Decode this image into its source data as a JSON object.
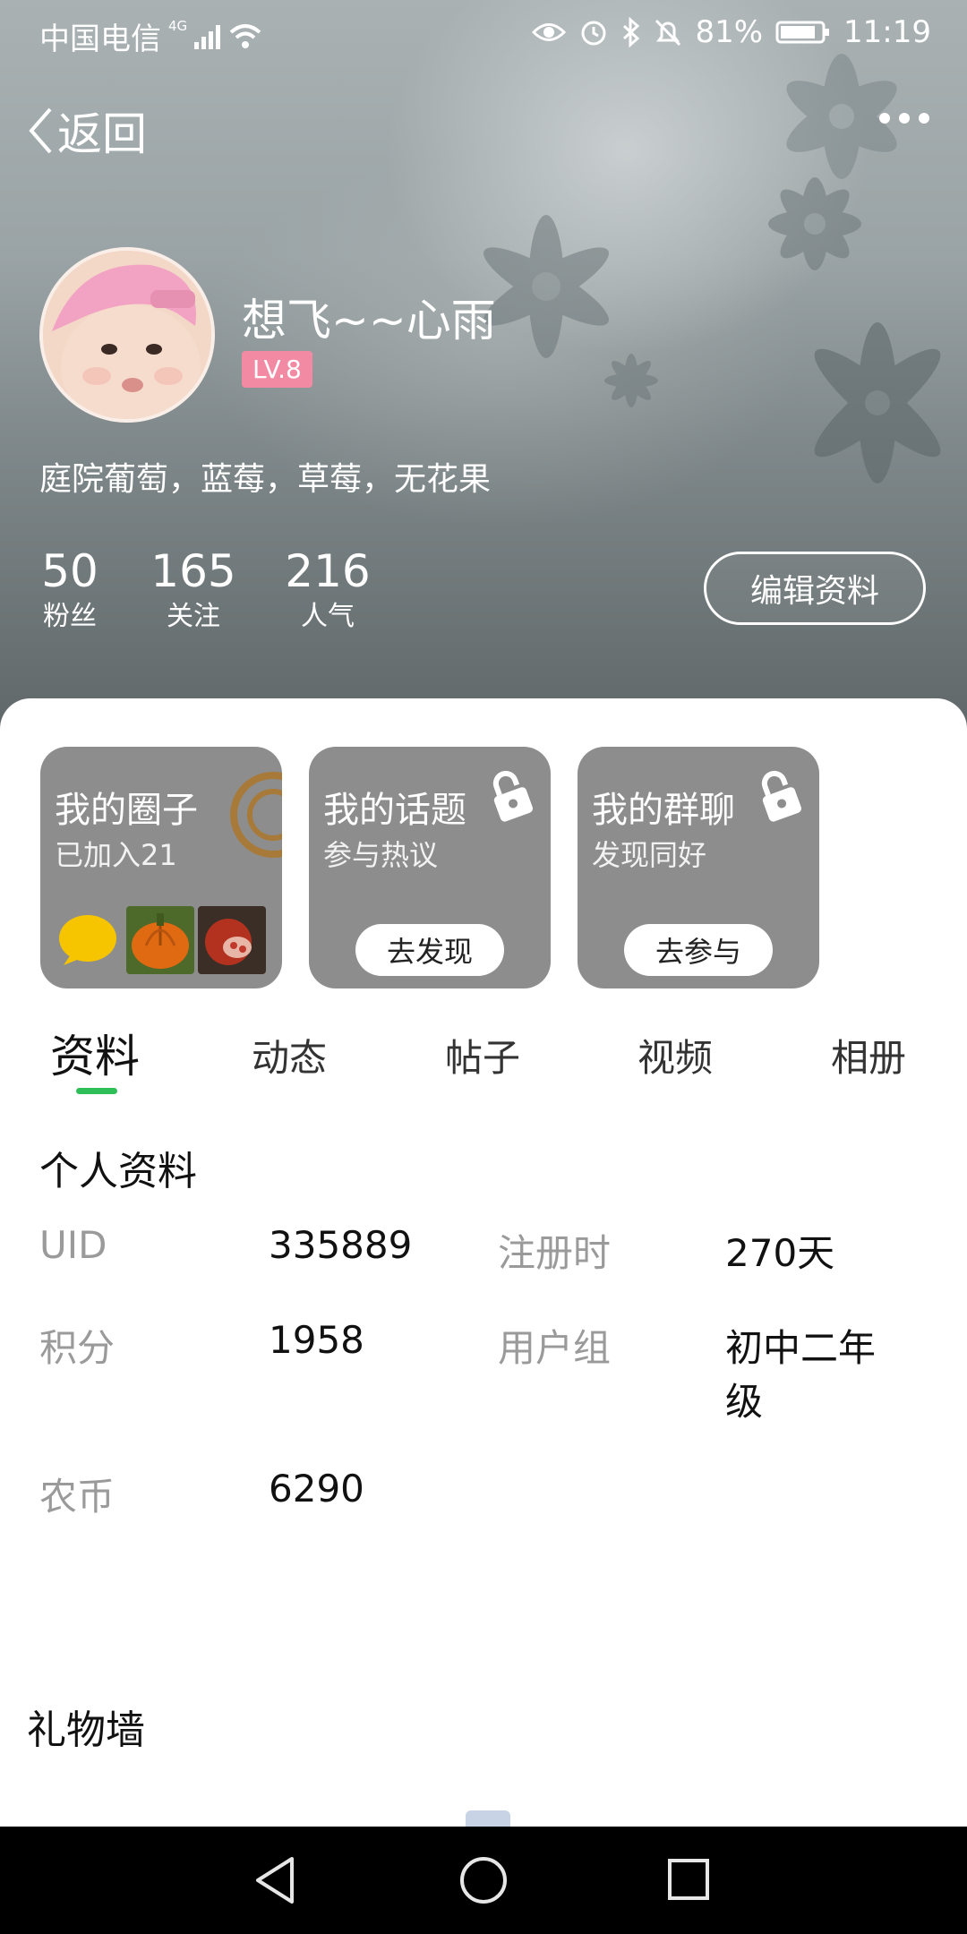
{
  "status": {
    "carrier": "中国电信",
    "network": "4G",
    "battery": "81%",
    "time": "11:19"
  },
  "nav": {
    "back_label": "返回"
  },
  "profile": {
    "nickname": "想飞~~心雨",
    "level": "LV.8",
    "signature": "庭院葡萄，蓝莓，草莓，无花果",
    "stats": [
      {
        "value": "50",
        "label": "粉丝"
      },
      {
        "value": "165",
        "label": "关注"
      },
      {
        "value": "216",
        "label": "人气"
      }
    ],
    "edit_label": "编辑资料"
  },
  "cards": [
    {
      "title": "我的圈子",
      "subtitle": "已加入21"
    },
    {
      "title": "我的话题",
      "subtitle": "参与热议",
      "button": "去发现"
    },
    {
      "title": "我的群聊",
      "subtitle": "发现同好",
      "button": "去参与"
    }
  ],
  "tabs": [
    "资料",
    "动态",
    "帖子",
    "视频",
    "相册"
  ],
  "active_tab": "资料",
  "info": {
    "section_title": "个人资料",
    "uid_label": "UID",
    "uid_value": "335889",
    "reg_label": "注册时",
    "reg_value": "270天",
    "points_label": "积分",
    "points_value": "1958",
    "group_label": "用户组",
    "group_value_1": "初中二年",
    "group_value_2": "级",
    "coin_label": "农币",
    "coin_value": "6290"
  },
  "gift_wall_title": "礼物墙",
  "colors": {
    "accent_green": "#2fbf58",
    "level_badge": "#f28aa4",
    "card_gray": "#8d8d8d"
  }
}
